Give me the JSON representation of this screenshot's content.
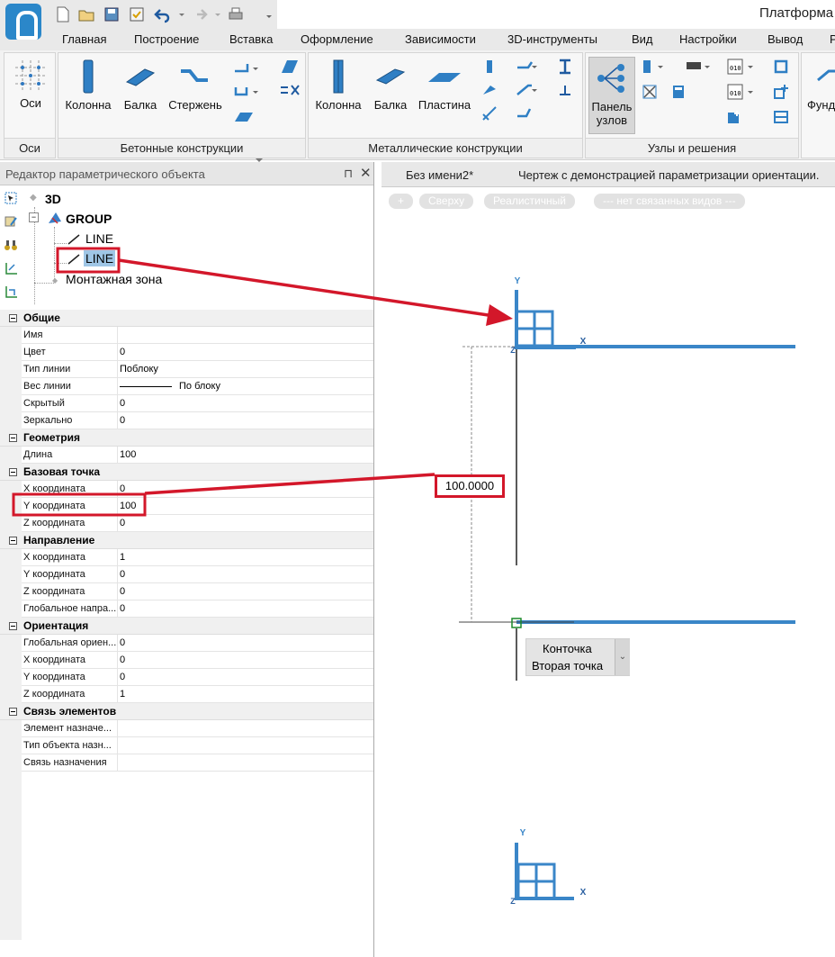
{
  "app": {
    "title": "Платформа"
  },
  "menu": {
    "tabs": [
      "Главная",
      "Построение",
      "Вставка",
      "Оформление",
      "Зависимости",
      "3D-инструменты",
      "Вид",
      "Настройки",
      "Вывод",
      "Р"
    ]
  },
  "ribbon": {
    "groups": {
      "axes": {
        "label": "Оси",
        "btn": "Оси"
      },
      "concrete": {
        "label": "Бетонные конструкции",
        "column": "Колонна",
        "beam": "Балка",
        "rods": "Стержень"
      },
      "metal": {
        "label": "Металлические конструкции",
        "column": "Колонна",
        "beam": "Балка",
        "plate": "Пластина"
      },
      "nodes": {
        "label": "Узлы и решения",
        "panel_line1": "Панель",
        "panel_line2": "узлов"
      },
      "foundation": {
        "btn": "Фунд"
      }
    }
  },
  "left_panel": {
    "title": "Редактор параметрического объекта",
    "tree": {
      "root": "3D",
      "group": "GROUP",
      "line1": "LINE",
      "line2": "LINE",
      "zone": "Монтажная зона"
    },
    "categories": {
      "general": "Общие",
      "geometry": "Геометрия",
      "base_point": "Базовая точка",
      "direction": "Направление",
      "orientation": "Ориентация",
      "links": "Связь элементов"
    },
    "general_rows": [
      {
        "key": "Имя",
        "value": ""
      },
      {
        "key": "Цвет",
        "value": "0"
      },
      {
        "key": "Тип линии",
        "value": "Поблоку"
      },
      {
        "key": "Вес линии",
        "value": "По блоку"
      },
      {
        "key": "Скрытый",
        "value": "0"
      },
      {
        "key": "Зеркально",
        "value": "0"
      }
    ],
    "geometry_rows": [
      {
        "key": "Длина",
        "value": "100"
      }
    ],
    "base_point_rows": [
      {
        "key": "X координата",
        "value": "0"
      },
      {
        "key": "Y координата",
        "value": "100"
      },
      {
        "key": "Z координата",
        "value": "0"
      }
    ],
    "direction_rows": [
      {
        "key": "X координата",
        "value": "1"
      },
      {
        "key": "Y координата",
        "value": "0"
      },
      {
        "key": "Z координата",
        "value": "0"
      },
      {
        "key": "Глобальное напра...",
        "value": "0"
      }
    ],
    "orientation_rows": [
      {
        "key": "Глобальная ориен...",
        "value": "0"
      },
      {
        "key": "X координата",
        "value": "0"
      },
      {
        "key": "Y координата",
        "value": "0"
      },
      {
        "key": "Z координата",
        "value": "1"
      }
    ],
    "links_rows": [
      {
        "key": "Элемент назначе...",
        "value": ""
      },
      {
        "key": "Тип объекта назн...",
        "value": ""
      },
      {
        "key": "Связь назначения",
        "value": ""
      }
    ]
  },
  "documents": {
    "tab1": "Без имени2*",
    "tab2": "Чертеж с демонстрацией параметризации ориентации."
  },
  "view_bar": {
    "plus": "+",
    "top": "Сверху",
    "realistic": "Реалистичный",
    "linked": "--- нет связанных видов ---"
  },
  "drawing": {
    "dimension": "100.0000",
    "snap_line1": "Конточка",
    "snap_line2": "Вторая точка",
    "axis_y": "Y",
    "axis_x": "X",
    "axis_z": "Z"
  },
  "colors": {
    "accent_blue": "#3a86c8",
    "annotation_red": "#d3172a"
  }
}
